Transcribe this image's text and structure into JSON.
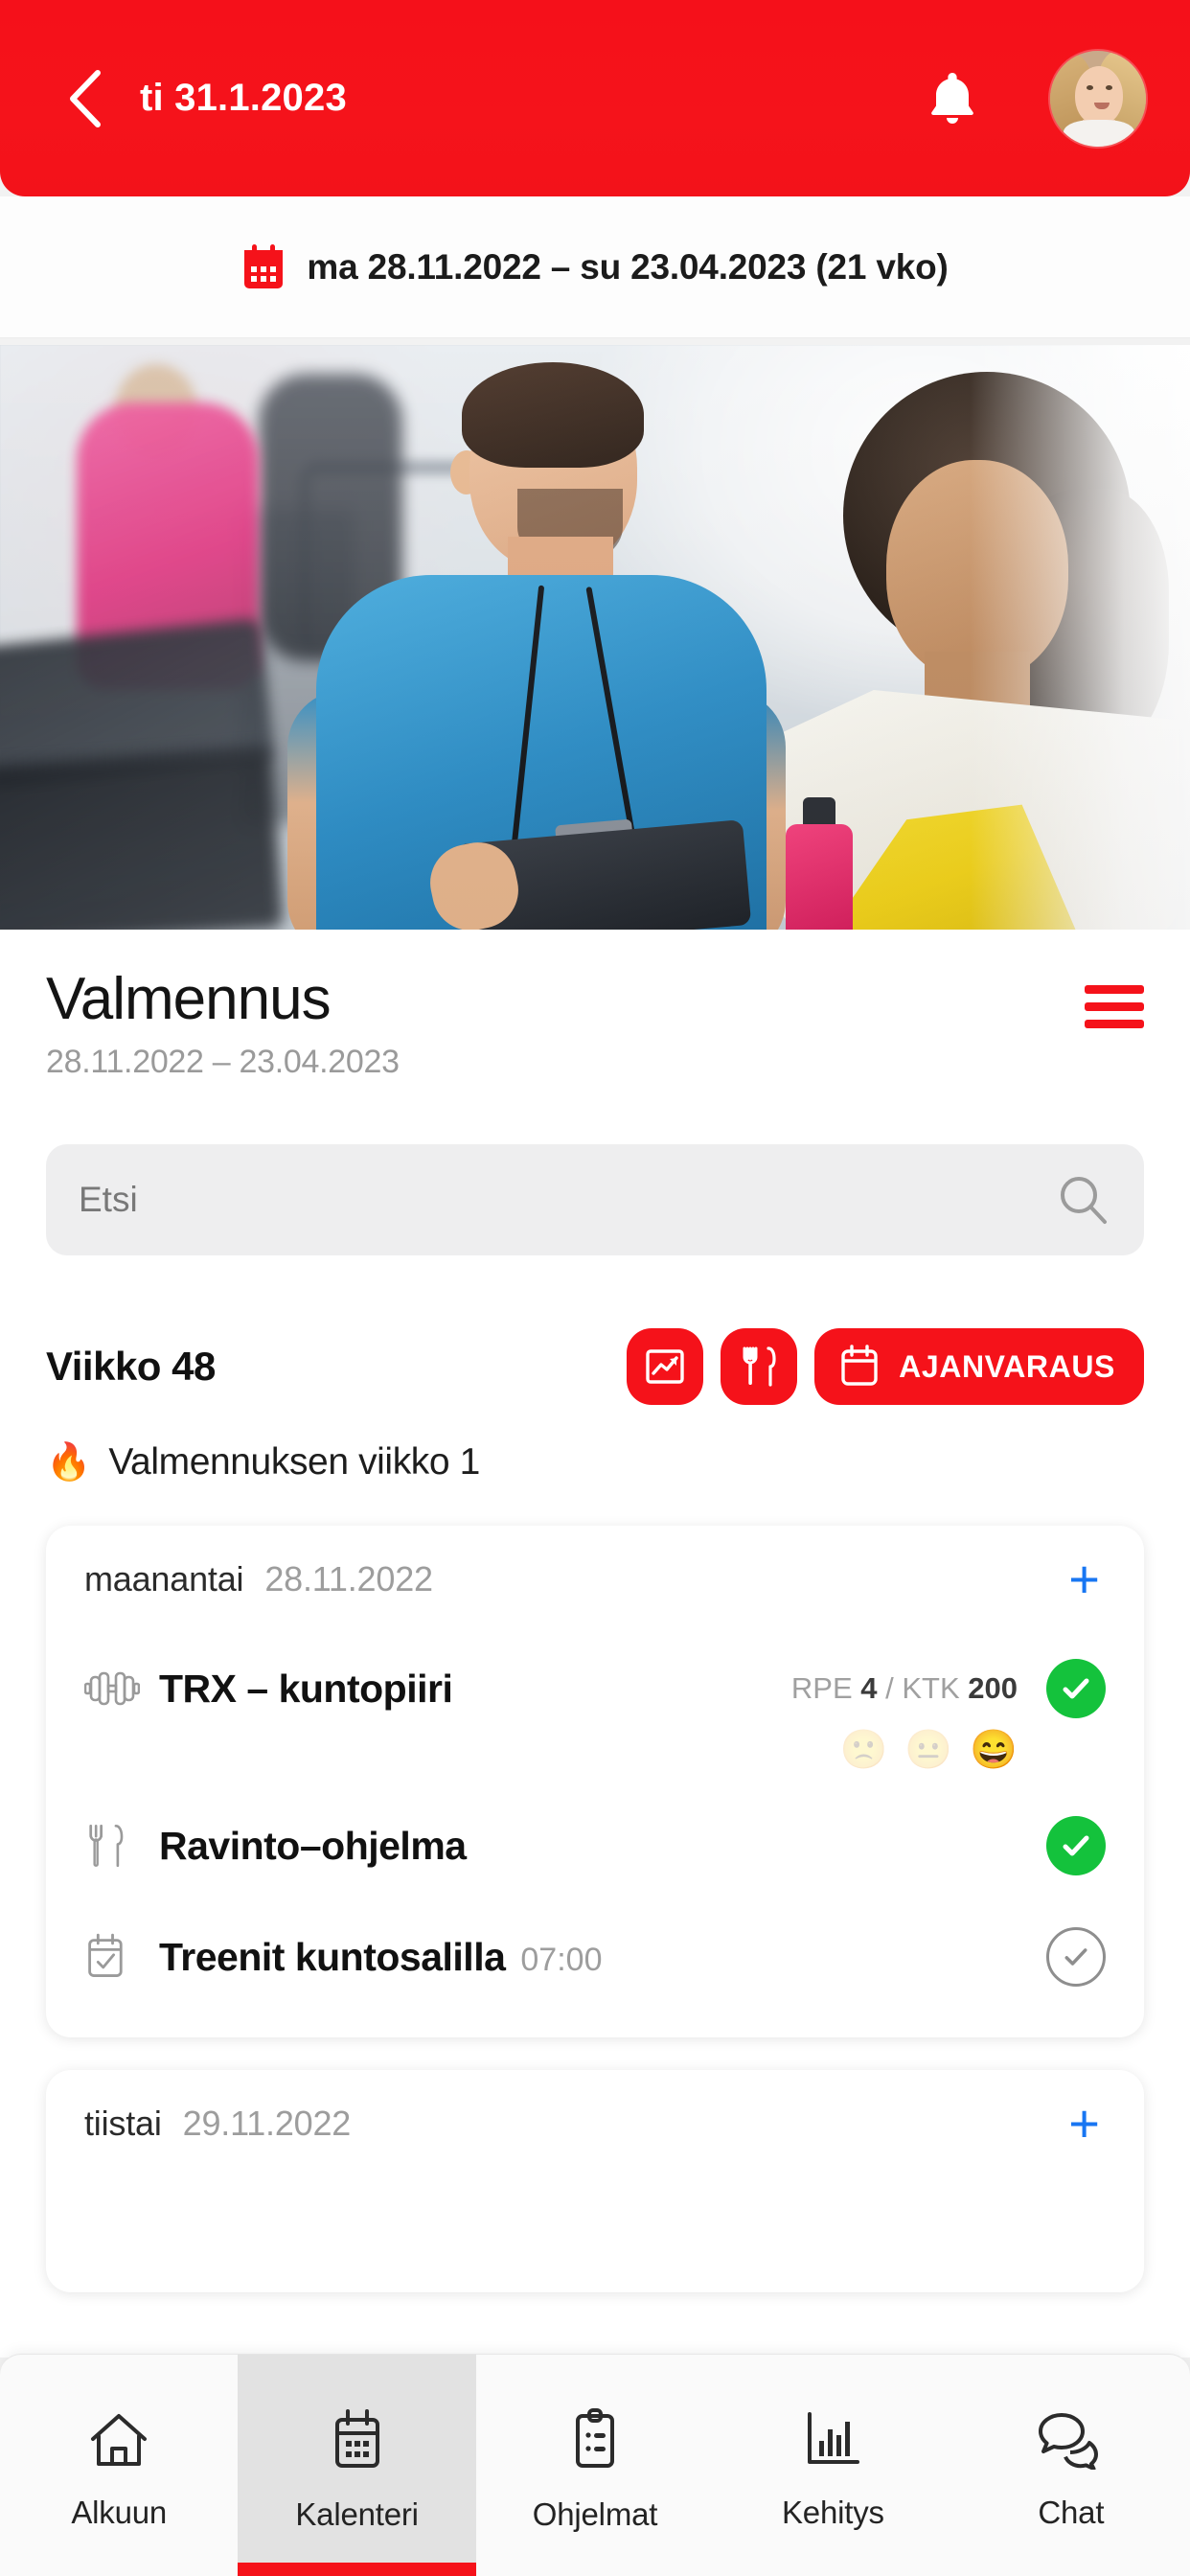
{
  "appbar": {
    "back_icon": "chevron-left-icon",
    "title": "ti 31.1.2023",
    "bell_icon": "bell-icon",
    "avatar_alt": "profile-avatar"
  },
  "range_bar": {
    "calendar_icon": "calendar-icon",
    "text": "ma 28.11.2022 – su 23.04.2023 (21 vko)"
  },
  "hero": {
    "alt": "personal-trainer-with-client-in-gym"
  },
  "page": {
    "title": "Valmennus",
    "subtitle": "28.11.2022 – 23.04.2023",
    "menu_icon": "hamburger-menu-icon",
    "accent_color": "#f5121a"
  },
  "search": {
    "placeholder": "Etsi",
    "value": "",
    "icon": "search-icon"
  },
  "week": {
    "label": "Viikko 48",
    "actions": [
      {
        "name": "stats-button",
        "icon": "chart-line-icon",
        "label": ""
      },
      {
        "name": "nutrition-button",
        "icon": "fork-knife-icon",
        "label": ""
      },
      {
        "name": "booking-button",
        "icon": "calendar-icon",
        "label": "AJANVARAUS"
      }
    ],
    "note_emoji": "🔥",
    "note_text": "Valmennuksen viikko 1"
  },
  "days": [
    {
      "name": "maanantai",
      "date": "28.11.2022",
      "add_label": "+",
      "items": [
        {
          "icon": "dumbbell-icon",
          "title": "TRX – kuntopiiri",
          "time": "",
          "meta_prefix": "RPE ",
          "meta_value1": "4",
          "meta_mid": " / KTK ",
          "meta_value2": "200",
          "status": "done",
          "feedback": [
            {
              "emoji": "🙁",
              "selected": false
            },
            {
              "emoji": "😐",
              "selected": false
            },
            {
              "emoji": "😄",
              "selected": true
            }
          ]
        },
        {
          "icon": "fork-knife-icon",
          "title": "Ravinto–ohjelma",
          "time": "",
          "meta_prefix": "",
          "meta_value1": "",
          "meta_mid": "",
          "meta_value2": "",
          "status": "done",
          "feedback": []
        },
        {
          "icon": "calendar-check-icon",
          "title": "Treenit kuntosalilla",
          "time": "07:00",
          "meta_prefix": "",
          "meta_value1": "",
          "meta_mid": "",
          "meta_value2": "",
          "status": "todo",
          "feedback": []
        }
      ]
    },
    {
      "name": "tiistai",
      "date": "29.11.2022",
      "add_label": "+",
      "items": []
    }
  ],
  "tabbar": {
    "items": [
      {
        "label": "Alkuun",
        "icon": "home-icon",
        "active": false
      },
      {
        "label": "Kalenteri",
        "icon": "calendar-icon",
        "active": true
      },
      {
        "label": "Ohjelmat",
        "icon": "clipboard-icon",
        "active": false
      },
      {
        "label": "Kehitys",
        "icon": "bar-chart-icon",
        "active": false
      },
      {
        "label": "Chat",
        "icon": "chat-icon",
        "active": false
      }
    ]
  }
}
